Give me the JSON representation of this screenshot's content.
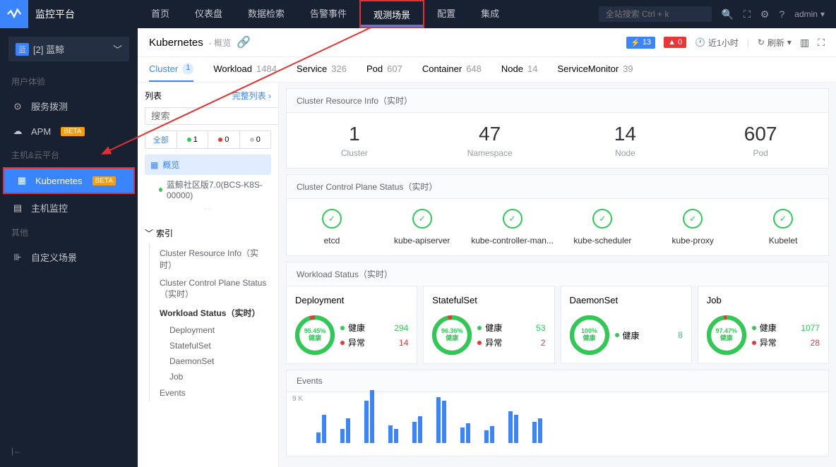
{
  "brand": "监控平台",
  "nav": [
    "首页",
    "仪表盘",
    "数据检索",
    "告警事件",
    "观测场景",
    "配置",
    "集成"
  ],
  "search_placeholder": "全站搜索 Ctrl + k",
  "admin": "admin",
  "tenant": {
    "badge": "蓝",
    "label": "[2] 蓝鲸"
  },
  "sidebar": {
    "sections": [
      {
        "title": "用户体验",
        "items": [
          {
            "label": "服务拨测",
            "icon": "⊙"
          },
          {
            "label": "APM",
            "icon": "☁",
            "beta": "BETA"
          }
        ]
      },
      {
        "title": "主机&云平台",
        "items": [
          {
            "label": "Kubernetes",
            "icon": "▦",
            "beta": "BETA",
            "active": true
          },
          {
            "label": "主机监控",
            "icon": "▤"
          }
        ]
      },
      {
        "title": "其他",
        "items": [
          {
            "label": "自定义场景",
            "icon": "⊪"
          }
        ]
      }
    ]
  },
  "breadcrumb": {
    "main": "Kubernetes",
    "sub": "- 概览"
  },
  "alerts": {
    "normal": "13",
    "error": "0"
  },
  "time": "近1小时",
  "refresh": "刷新",
  "tabs": [
    {
      "label": "Cluster",
      "count": "1",
      "active": true
    },
    {
      "label": "Workload",
      "count": "1484"
    },
    {
      "label": "Service",
      "count": "326"
    },
    {
      "label": "Pod",
      "count": "607"
    },
    {
      "label": "Container",
      "count": "648"
    },
    {
      "label": "Node",
      "count": "14"
    },
    {
      "label": "ServiceMonitor",
      "count": "39"
    }
  ],
  "left": {
    "list": "列表",
    "full": "完整列表 ›",
    "search": "搜索",
    "filters": {
      "all": "全部",
      "green": "1",
      "red": "0",
      "grey": "0"
    },
    "overview": "概览",
    "cluster": "蓝鲸社区版7.0(BCS-K8S-00000)",
    "index": "索引",
    "index_items": [
      {
        "label": "Cluster Resource Info（实时）"
      },
      {
        "label": "Cluster Control Plane Status（实时）"
      },
      {
        "label": "Workload Status（实时）",
        "bold": true,
        "children": [
          "Deployment",
          "StatefulSet",
          "DaemonSet",
          "Job"
        ]
      },
      {
        "label": "Events"
      }
    ]
  },
  "cards": {
    "resource": {
      "title": "Cluster Resource Info（实时）",
      "stats": [
        {
          "num": "1",
          "label": "Cluster"
        },
        {
          "num": "47",
          "label": "Namespace"
        },
        {
          "num": "14",
          "label": "Node"
        },
        {
          "num": "607",
          "label": "Pod"
        }
      ]
    },
    "control": {
      "title": "Cluster Control Plane Status（实时）",
      "items": [
        "etcd",
        "kube-apiserver",
        "kube-controller-man...",
        "kube-scheduler",
        "kube-proxy",
        "Kubelet"
      ]
    },
    "workload": {
      "title": "Workload Status（实时）",
      "healthy_label": "健康",
      "error_label": "异常",
      "items": [
        {
          "name": "Deployment",
          "pct": "95.45%",
          "healthy": "294",
          "error": "14"
        },
        {
          "name": "StatefulSet",
          "pct": "96.36%",
          "healthy": "53",
          "error": "2"
        },
        {
          "name": "DaemonSet",
          "pct": "100%",
          "healthy": "8",
          "error": null
        },
        {
          "name": "Job",
          "pct": "97.47%",
          "healthy": "1077",
          "error": "28"
        }
      ]
    },
    "events": {
      "title": "Events",
      "ylabel": "9 K"
    }
  },
  "chart_data": {
    "type": "bar",
    "ylabel": "9 K",
    "bars": [
      [
        15,
        40
      ],
      [
        20,
        35
      ],
      [
        60,
        75
      ],
      [
        25,
        20
      ],
      [
        30,
        38
      ],
      [
        65,
        60
      ],
      [
        22,
        28
      ],
      [
        18,
        24
      ],
      [
        45,
        40
      ],
      [
        30,
        35
      ]
    ]
  }
}
